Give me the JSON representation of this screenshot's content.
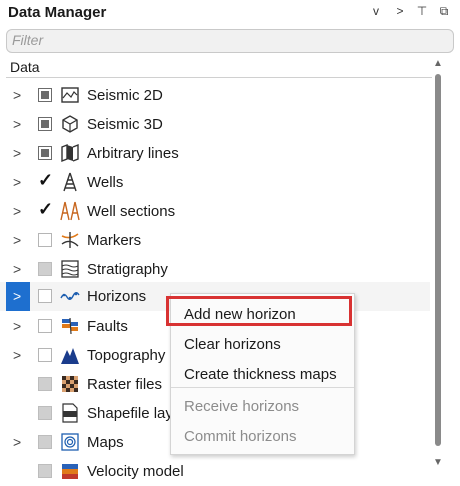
{
  "header": {
    "title": "Data Manager",
    "ctrl_dropdown": "v",
    "ctrl_next": ">",
    "ctrl_pin": "⊤",
    "ctrl_float": "⧉"
  },
  "filter": {
    "placeholder": "Filter",
    "value": ""
  },
  "tree": {
    "column": "Data",
    "items": [
      {
        "label": "Seismic 2D",
        "check": "partial",
        "icon": "seismic-2d-icon"
      },
      {
        "label": "Seismic 3D",
        "check": "partial",
        "icon": "seismic-3d-icon"
      },
      {
        "label": "Arbitrary lines",
        "check": "partial",
        "icon": "arbitrary-lines-icon"
      },
      {
        "label": "Wells",
        "check": "checked",
        "icon": "well-derrick-icon"
      },
      {
        "label": "Well sections",
        "check": "checked",
        "icon": "well-sections-icon"
      },
      {
        "label": "Markers",
        "check": "empty",
        "icon": "markers-icon"
      },
      {
        "label": "Stratigraphy",
        "check": "grey",
        "icon": "stratigraphy-icon"
      },
      {
        "label": "Horizons",
        "check": "empty",
        "icon": "horizons-icon"
      },
      {
        "label": "Faults",
        "check": "empty",
        "icon": "faults-icon"
      },
      {
        "label": "Topography",
        "check": "empty",
        "icon": "topography-icon"
      },
      {
        "label": "Raster files",
        "check": "grey",
        "icon": "raster-files-icon"
      },
      {
        "label": "Shapefile layers",
        "check": "grey",
        "icon": "shapefile-icon"
      },
      {
        "label": "Maps",
        "check": "grey",
        "icon": "maps-icon"
      },
      {
        "label": "Velocity model",
        "check": "grey",
        "icon": "velocity-model-icon"
      }
    ]
  },
  "context_menu": {
    "items": [
      {
        "label": "Add new horizon",
        "enabled": true
      },
      {
        "label": "Clear horizons",
        "enabled": true
      },
      {
        "label": "Create thickness maps",
        "enabled": true
      },
      {
        "label": "Receive horizons",
        "enabled": false
      },
      {
        "label": "Commit horizons",
        "enabled": false
      }
    ]
  },
  "colors": {
    "selection": "#1e6fcf",
    "highlight": "#d83232"
  }
}
